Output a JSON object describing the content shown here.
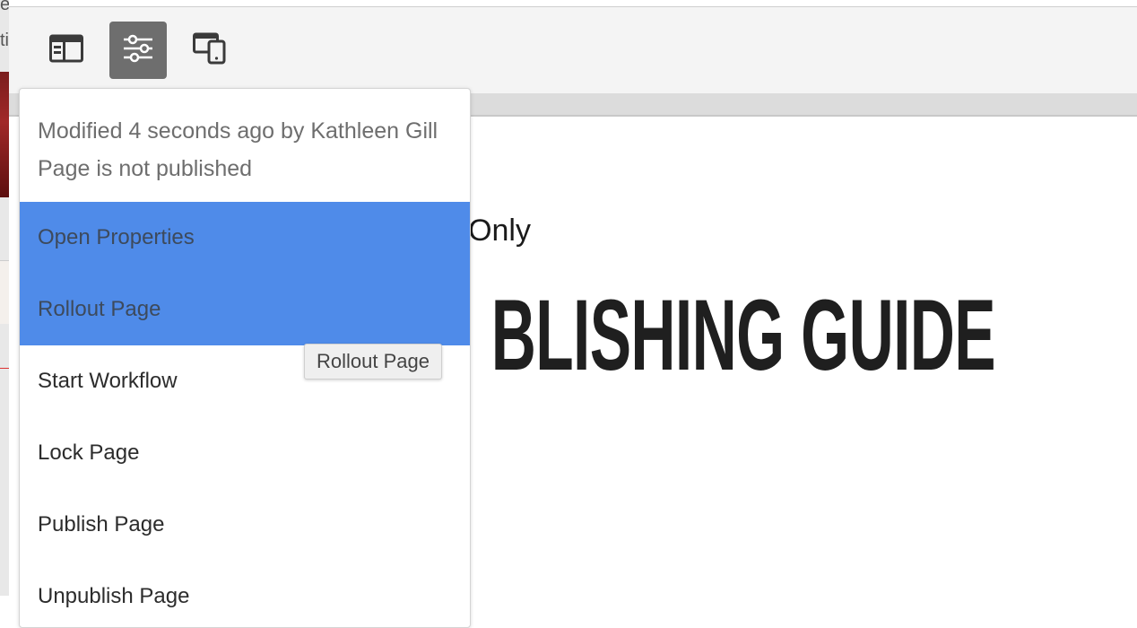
{
  "toolbar": {
    "buttons": [
      {
        "icon": "side-panel-icon"
      },
      {
        "icon": "page-properties-icon",
        "active": true
      },
      {
        "icon": "emulator-icon"
      }
    ]
  },
  "background_window": {
    "fragment_top": "e",
    "fragment_second": "ti"
  },
  "page": {
    "subtitle": "Only",
    "headline": "BLISHING GUIDE"
  },
  "popover": {
    "modified_text": "Modified 4 seconds ago by Kathleen Gill",
    "publish_status": "Page is not published",
    "items": [
      {
        "label": "Open Properties",
        "highlighted": true
      },
      {
        "label": "Rollout Page",
        "highlighted": true
      },
      {
        "label": "Start Workflow"
      },
      {
        "label": "Lock Page"
      },
      {
        "label": "Publish Page"
      },
      {
        "label": "Unpublish Page"
      }
    ]
  },
  "tooltip": {
    "text": "Rollout Page"
  },
  "colors": {
    "highlight": "#4f8be9",
    "active_button": "#6e6e6e",
    "toolbar_bg": "#f4f4f4"
  }
}
